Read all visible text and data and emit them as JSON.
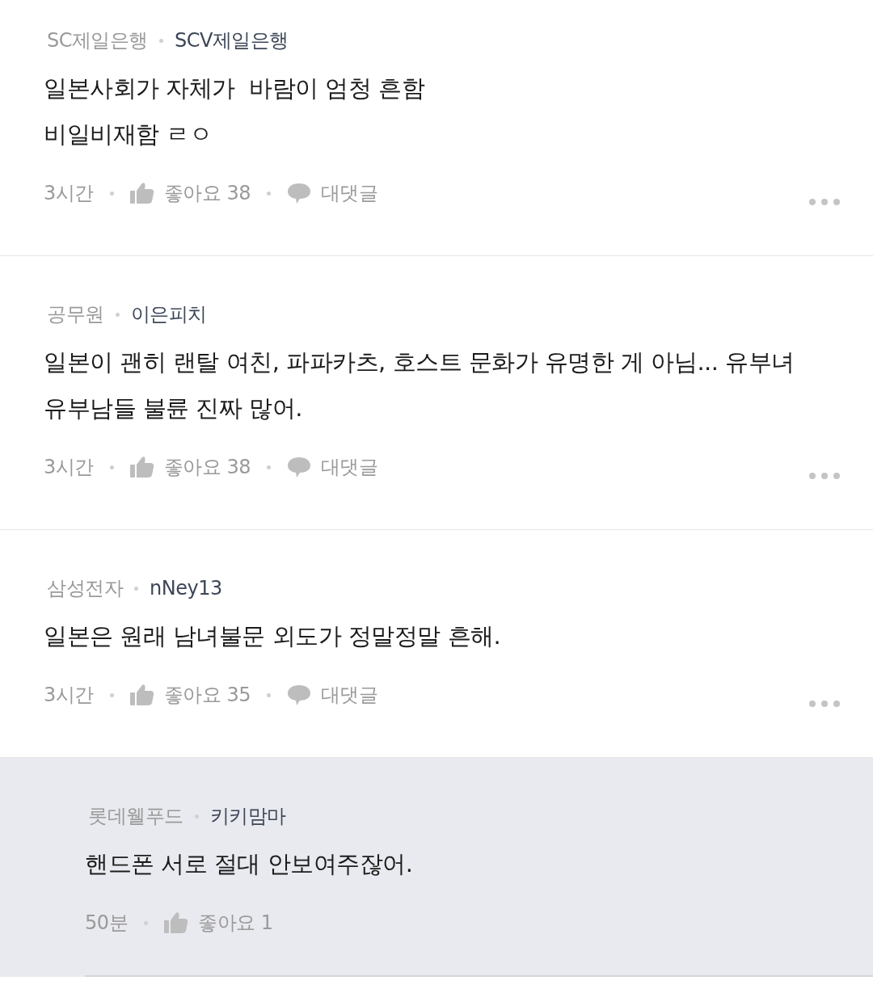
{
  "comments": [
    {
      "kind": "comment",
      "company": "SC제일은행",
      "nickname": "SCV제일은행",
      "lines": [
        "일본사회가 자체가  바람이 엄청 흔함",
        "비일비재함 ㄹㅇ"
      ],
      "time": "3시간",
      "likes": "좋아요 38",
      "reply_label": "대댓글"
    },
    {
      "kind": "comment",
      "company": "공무원",
      "nickname": "이은피치",
      "lines": [
        "일본이 괜히 랜탈 여친, 파파카츠, 호스트 문화가 유명한 게 아님... 유부녀",
        "유부남들 불륜 진짜 많어."
      ],
      "time": "3시간",
      "likes": "좋아요 38",
      "reply_label": "대댓글"
    },
    {
      "kind": "comment",
      "company": "삼성전자",
      "nickname": "nNey13",
      "lines": [
        "일본은 원래 남녀불문 외도가 정말정말 흔해."
      ],
      "time": "3시간",
      "likes": "좋아요 35",
      "reply_label": "대댓글"
    },
    {
      "kind": "reply",
      "company": "롯데웰푸드",
      "nickname": "키키맘마",
      "lines": [
        "핸드폰 서로 절대 안보여주잖어."
      ],
      "time": "50분",
      "likes": "좋아요 1"
    }
  ]
}
